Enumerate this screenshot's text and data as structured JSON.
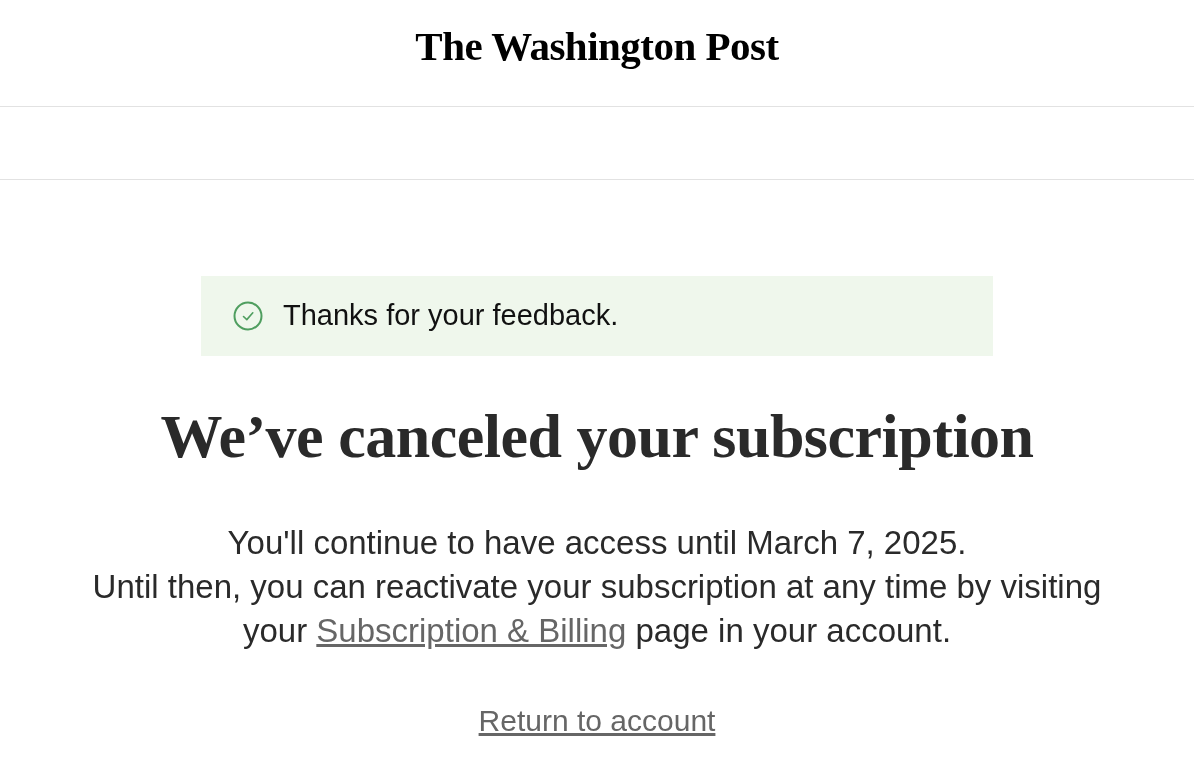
{
  "header": {
    "logo": "The Washington Post"
  },
  "notice": {
    "kind": "success",
    "text": "Thanks for your feedback."
  },
  "heading": "We’ve canceled your subscription",
  "access_note": "You'll continue to have access until March 7, 2025.",
  "reactivate_note": {
    "before": "Until then, you can reactivate your subscription at any time by visiting your",
    "link": "Subscription & Billing",
    "after": "page in your account."
  },
  "return_link": "Return to account"
}
